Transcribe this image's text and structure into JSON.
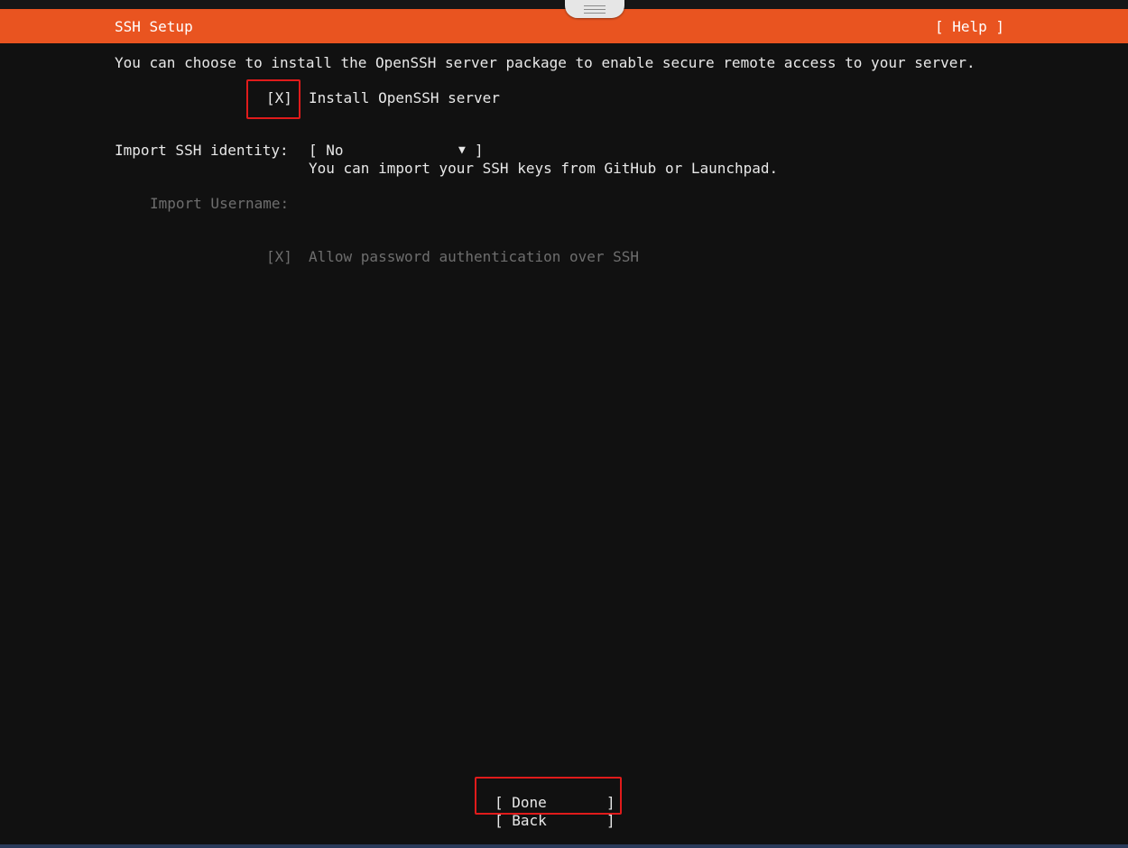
{
  "header": {
    "title": "SSH Setup",
    "help_label": "[ Help ]"
  },
  "intro_text": "You can choose to install the OpenSSH server package to enable secure remote access to your server.",
  "install_openssh": {
    "checkbox": "[X]",
    "label": "Install OpenSSH server"
  },
  "import_identity": {
    "label": "Import SSH identity:",
    "select_open": "[ No",
    "select_arrow": "▼",
    "select_close": "]",
    "hint": "You can import your SSH keys from GitHub or Launchpad."
  },
  "import_username": {
    "label": "Import Username:",
    "value": ""
  },
  "allow_password": {
    "checkbox": "[X]",
    "label": "Allow password authentication over SSH"
  },
  "buttons": {
    "done_open": "[ Done",
    "done_close": "]",
    "back_open": "[ Back",
    "back_close": "]"
  },
  "colors": {
    "header_bg": "#e95420",
    "highlight_box": "#e01b1b",
    "background": "#111111"
  }
}
